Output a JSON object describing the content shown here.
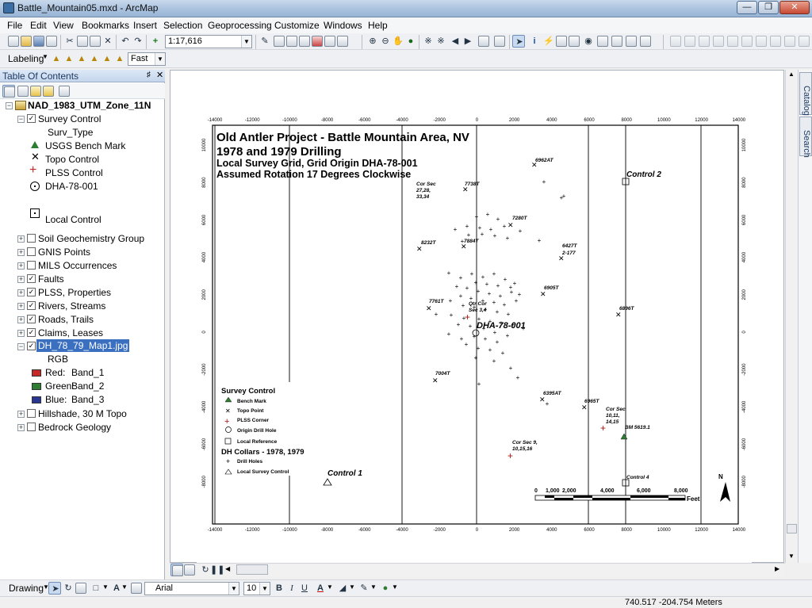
{
  "window": {
    "title": "Battle_Mountain05.mxd - ArcMap"
  },
  "menu": [
    "File",
    "Edit",
    "View",
    "Bookmarks",
    "Insert",
    "Selection",
    "Geoprocessing",
    "Customize",
    "Windows",
    "Help"
  ],
  "standard_toolbar": {
    "scale": "1:17,616"
  },
  "labeling_toolbar": {
    "label": "Labeling",
    "quality": "Fast"
  },
  "toc": {
    "title": "Table Of Contents",
    "root": "NAD_1983_UTM_Zone_11N",
    "survey_control": {
      "name": "Survey Control",
      "field": "Surv_Type",
      "classes": [
        "USGS Bench Mark",
        "Topo Control",
        "PLSS Control",
        "DHA-78-001",
        "Local Control"
      ]
    },
    "layers": [
      "Soil Geochemistry Group",
      "GNIS Points",
      "MILS Occurrences",
      "Faults",
      "PLSS, Properties",
      "Rivers, Streams",
      "Roads, Trails",
      "Claims, Leases"
    ],
    "raster": {
      "name": "DH_78_79_Map1.jpg",
      "mode": "RGB",
      "bands": [
        {
          "label": "Red:",
          "band": "Band_1",
          "color": "#c62828"
        },
        {
          "label": "Green:",
          "band": "Band_2",
          "color": "#2e7d32"
        },
        {
          "label": "Blue:",
          "band": "Band_3",
          "color": "#283593"
        }
      ]
    },
    "bottom_layers": [
      "Hillshade, 30 M Topo",
      "Bedrock Geology"
    ]
  },
  "map": {
    "title": "Old Antler Project - Battle Mountain Area, NV",
    "subtitle": "1978 and 1979 Drilling",
    "line3": "Local Survey Grid, Grid Origin DHA-78-001",
    "line4": "Assumed Rotation 17 Degrees Clockwise",
    "x_ticks": [
      "-14000",
      "-12000",
      "-10000",
      "-8000",
      "-6000",
      "-4000",
      "-2000",
      "0",
      "2000",
      "4000",
      "6000",
      "8000",
      "10000",
      "12000",
      "14000"
    ],
    "y_ticks": [
      "10000",
      "8000",
      "6000",
      "4000",
      "2000",
      "0",
      "-2000",
      "-4000",
      "-6000",
      "-8000"
    ],
    "points": [
      {
        "label": "6962AT"
      },
      {
        "label": "Control 2"
      },
      {
        "label": "Cor Sec\n27,28,\n33,34"
      },
      {
        "label": "7738T"
      },
      {
        "label": "7280T"
      },
      {
        "label": "8232T"
      },
      {
        "label": "7884T"
      },
      {
        "label": "6427T\n2-177"
      },
      {
        "label": "6905T"
      },
      {
        "label": "7761T"
      },
      {
        "label": "Qtr Cor\nSec 3,4"
      },
      {
        "label": "DHA-78-001"
      },
      {
        "label": "6896T"
      },
      {
        "label": "7004T"
      },
      {
        "label": "6395AT"
      },
      {
        "label": "6965T"
      },
      {
        "label": "Cor Sec\n10,11,\n14,15"
      },
      {
        "label": "BM 5619.1"
      },
      {
        "label": "Cor Sec 9,\n10,15,16"
      },
      {
        "label": "Control 1"
      },
      {
        "label": "Control 4"
      }
    ],
    "legend": {
      "title": "Survey Control",
      "items": [
        "Bench Mark",
        "Topo Point",
        "PLSS Corner",
        "Origin Drill Hole",
        "Local Reference"
      ],
      "title2": "DH Collars - 1978, 1979",
      "items2": [
        "Drill Holes",
        "Local Survey Control"
      ]
    },
    "scalebar": {
      "labels": [
        "0",
        "1,000",
        "2,000",
        "4,000",
        "6,000",
        "8,000"
      ],
      "unit": "Feet"
    },
    "north": "N"
  },
  "drawing_toolbar": {
    "label": "Drawing",
    "font": "Arial",
    "size": "10",
    "bold": "B",
    "italic": "I",
    "underline": "U",
    "fontcolor": "A"
  },
  "status": {
    "coords": "740.517  -204.754 Meters"
  }
}
